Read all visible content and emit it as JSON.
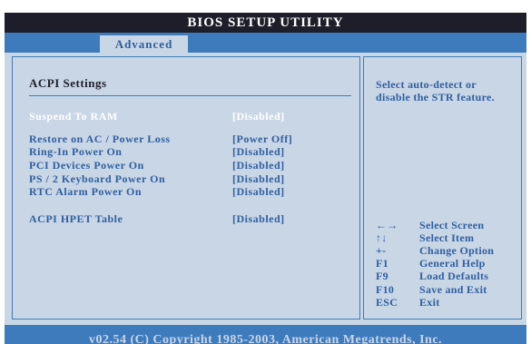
{
  "app": {
    "title": "BIOS SETUP UTILITY"
  },
  "tabs": [
    {
      "label": "Advanced"
    }
  ],
  "section": {
    "title": "ACPI Settings"
  },
  "settings": [
    {
      "label": "Suspend To RAM",
      "value": "[Disabled]",
      "selected": true
    },
    {
      "label": "Restore on AC / Power Loss",
      "value": "[Power Off]"
    },
    {
      "label": "Ring-In Power On",
      "value": "[Disabled]"
    },
    {
      "label": "PCI Devices Power On",
      "value": "[Disabled]"
    },
    {
      "label": "PS / 2 Keyboard Power On",
      "value": "[Disabled]"
    },
    {
      "label": "RTC Alarm Power On",
      "value": "[Disabled]"
    },
    {
      "label": "ACPI HPET Table",
      "value": "[Disabled]"
    }
  ],
  "help": {
    "text": "Select auto-detect or disable the STR feature."
  },
  "keys": [
    {
      "key": "←→",
      "desc": "Select Screen"
    },
    {
      "key": "↑↓",
      "desc": "Select Item"
    },
    {
      "key": "+-",
      "desc": "Change Option"
    },
    {
      "key": "F1",
      "desc": "General Help"
    },
    {
      "key": "F9",
      "desc": "Load Defaults"
    },
    {
      "key": "F10",
      "desc": "Save and Exit"
    },
    {
      "key": "ESC",
      "desc": "Exit"
    }
  ],
  "footer": {
    "text": "v02.54 (C) Copyright 1985-2003, American Megatrends, Inc."
  },
  "colors": {
    "title_bar": "#1e1e2a",
    "tab_strip": "#3e7bbd",
    "panel_bg": "#c9d6e6",
    "text": "#2f5fa0",
    "highlight_text": "#ffffff"
  }
}
